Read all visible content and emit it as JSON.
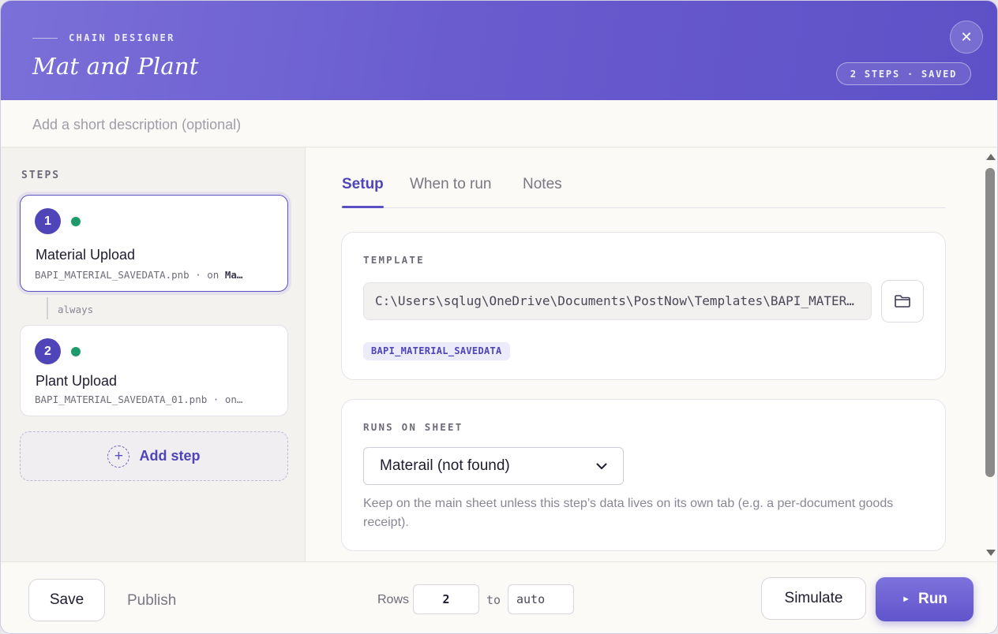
{
  "header": {
    "eyebrow": "CHAIN DESIGNER",
    "title": "Mat and Plant",
    "status": "2 STEPS · SAVED",
    "close_glyph": "✕"
  },
  "description": {
    "placeholder": "Add a short description (optional)",
    "value": ""
  },
  "sidebar": {
    "heading": "STEPS",
    "steps": [
      {
        "number": "1",
        "name": "Material Upload",
        "file": "BAPI_MATERIAL_SAVEDATA.pnb",
        "sep": " · on ",
        "sheet": "Ma…",
        "status_color": "#1f9a6b"
      },
      {
        "number": "2",
        "name": "Plant Upload",
        "file": "BAPI_MATERIAL_SAVEDATA_01.pnb",
        "sep": " · on…",
        "sheet": "",
        "status_color": "#1f9a6b"
      }
    ],
    "connector_label": "always",
    "add_step_label": "Add step"
  },
  "tabs": [
    {
      "label": "Setup",
      "active": true
    },
    {
      "label": "When to run",
      "active": false
    },
    {
      "label": "Notes",
      "active": false
    }
  ],
  "template_card": {
    "label": "TEMPLATE",
    "path": "C:\\Users\\sqlug\\OneDrive\\Documents\\PostNow\\Templates\\BAPI_MATERIAL_SAVEDATA.pnb",
    "tag": "BAPI_MATERIAL_SAVEDATA"
  },
  "sheet_card": {
    "label": "RUNS ON SHEET",
    "selected": "Materail (not found)",
    "hint": "Keep on the main sheet unless this step’s data lives on its own tab (e.g. a per-document goods receipt)."
  },
  "footer": {
    "save_label": "Save",
    "publish_label": "Publish",
    "rows_label": "Rows",
    "rows_from": "2",
    "to_label": "to",
    "rows_to_placeholder": "auto",
    "simulate_label": "Simulate",
    "run_label": "Run",
    "run_glyph": "►"
  },
  "colors": {
    "accent": "#5b4fc4",
    "header_start": "#7b6fd8",
    "header_end": "#5e50c6",
    "status_green": "#1f9a6b"
  }
}
